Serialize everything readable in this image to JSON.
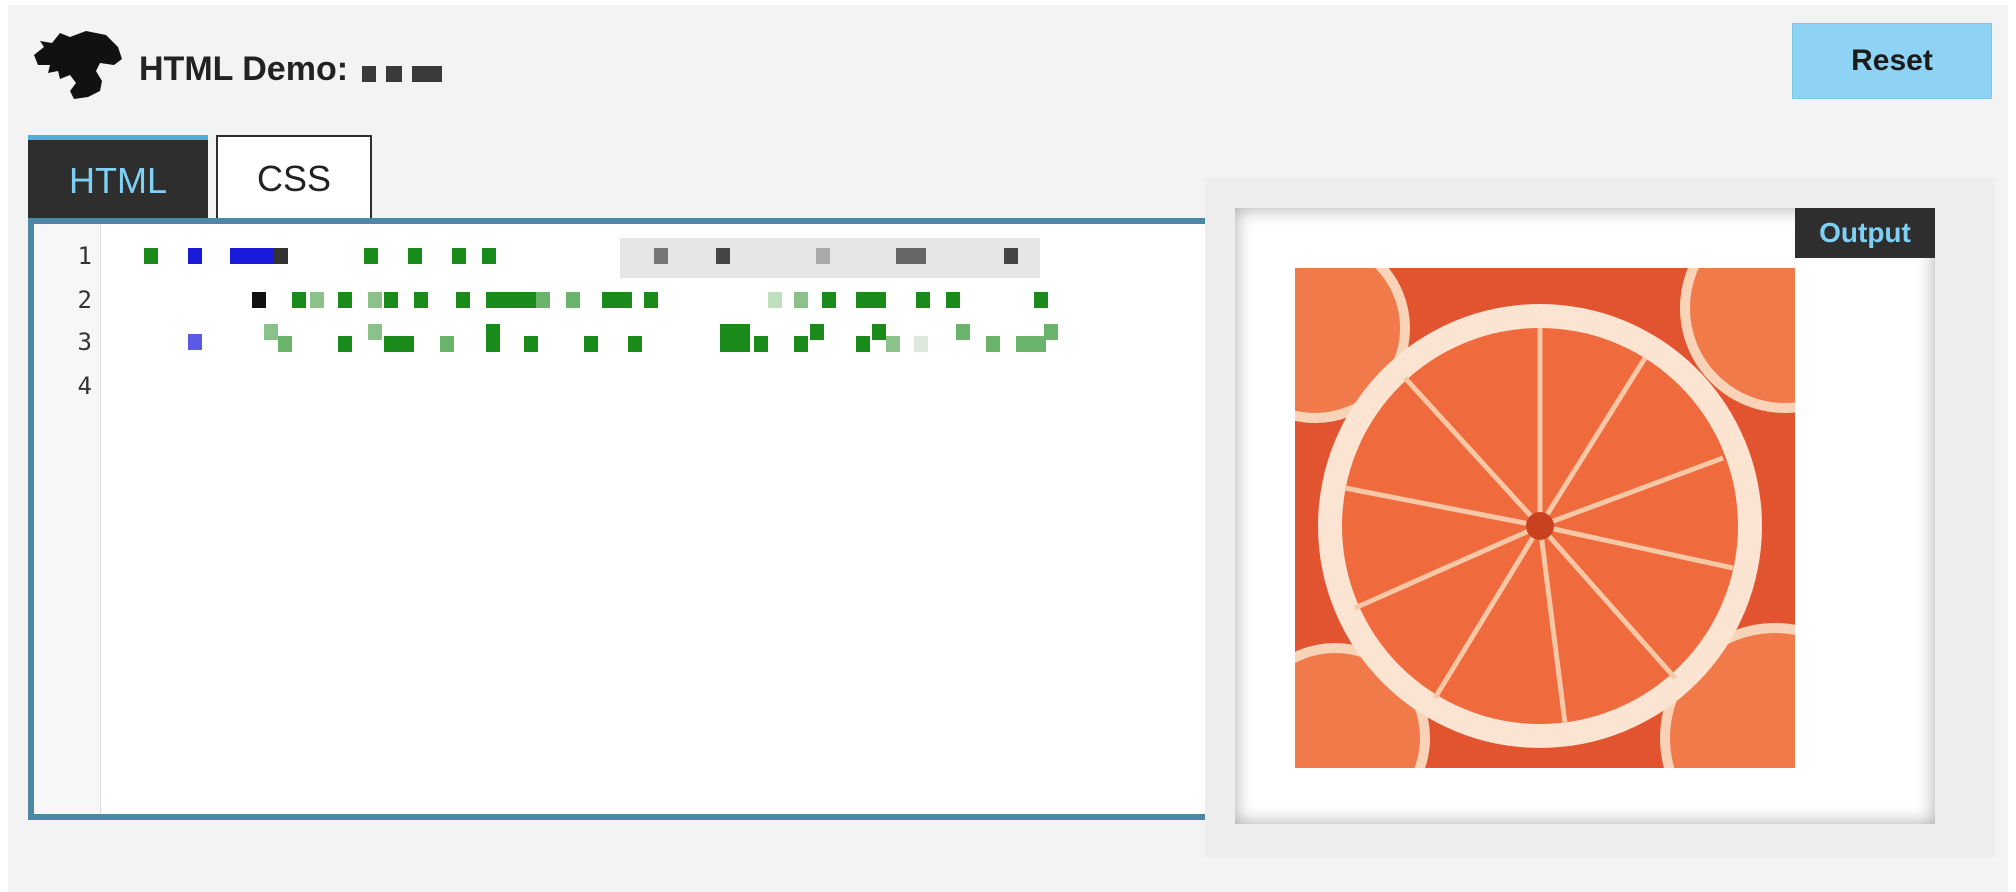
{
  "header": {
    "title": "HTML Demo:",
    "reset_label": "Reset"
  },
  "tabs": [
    {
      "label": "HTML",
      "active": true
    },
    {
      "label": "CSS",
      "active": false
    }
  ],
  "editor": {
    "line_numbers": [
      "1",
      "2",
      "3",
      "4"
    ]
  },
  "output": {
    "label": "Output",
    "image": "orange-slice"
  },
  "colors": {
    "accent": "#8fd3f4",
    "tab_active_bg": "#2e2e2e",
    "tab_active_text": "#7fd0f5",
    "editor_border": "#4b88a6",
    "syntax_green": "#1a8a1a",
    "syntax_blue": "#1a1ad8",
    "orange": "#ef6a3c"
  }
}
